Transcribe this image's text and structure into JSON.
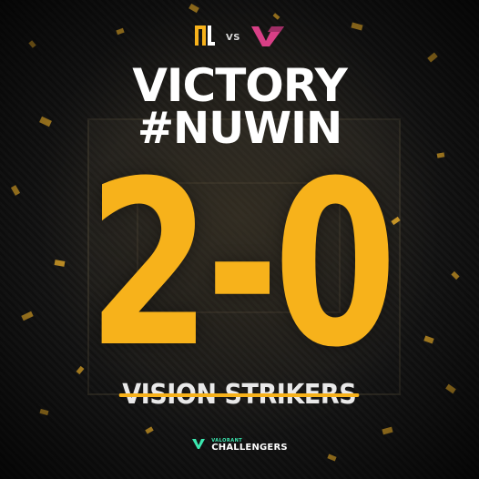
{
  "matchup": {
    "vs_label": "VS"
  },
  "headline": {
    "line1": "VICTORY",
    "line2": "#NUWIN"
  },
  "score": {
    "text": "2-0"
  },
  "opponent": {
    "name": "VISION STRIKERS"
  },
  "footer": {
    "small": "VALORANT",
    "big": "CHALLENGERS"
  },
  "colors": {
    "accent": "#f7b21b",
    "footer_accent": "#3be8b0",
    "opponent_logo": "#d83f86"
  },
  "icons": [
    "nu-logo-icon",
    "vs-logo-icon",
    "valorant-challengers-logo-icon"
  ]
}
